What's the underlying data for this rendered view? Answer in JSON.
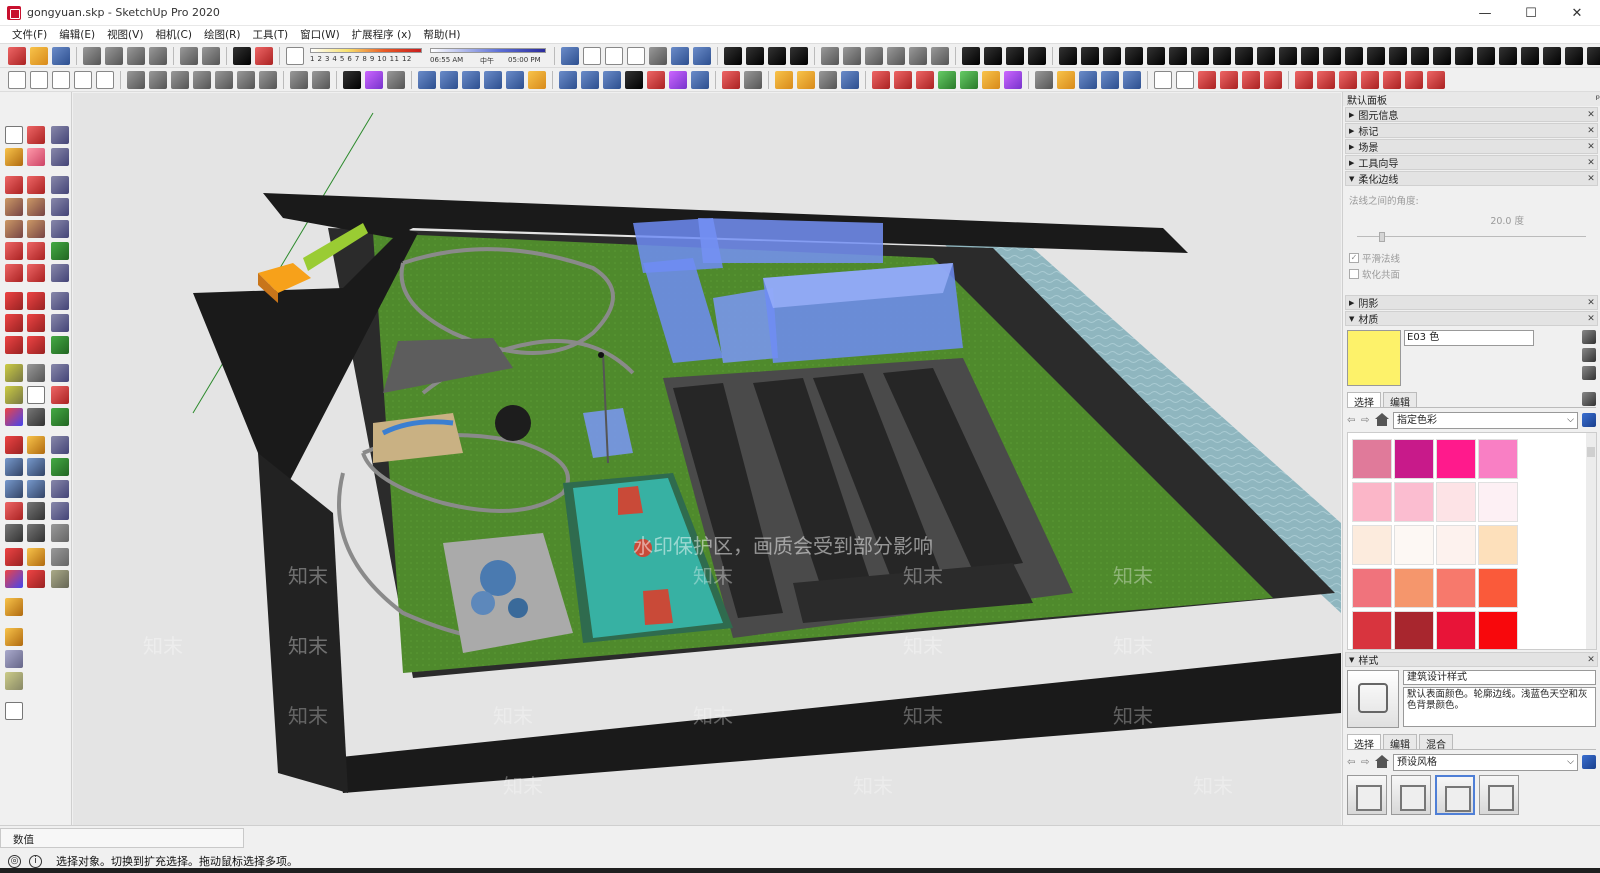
{
  "window": {
    "title": "gongyuan.skp - SketchUp Pro 2020",
    "controls": {
      "minimize": "—",
      "maximize": "☐",
      "close": "✕"
    }
  },
  "menubar": [
    "文件(F)",
    "编辑(E)",
    "视图(V)",
    "相机(C)",
    "绘图(R)",
    "工具(T)",
    "窗口(W)",
    "扩展程序 (x)",
    "帮助(H)"
  ],
  "toolbar": {
    "shadow_ticks": "1 2 3 4 5 6 7 8 9 10 11 12",
    "time_start": "06:55 AM",
    "time_mid": "中午",
    "time_end": "05:00 PM"
  },
  "right_panel": {
    "title": "默认面板",
    "pin": "ᵖ",
    "sections": [
      {
        "label": "图元信息",
        "expanded": false
      },
      {
        "label": "标记",
        "expanded": false
      },
      {
        "label": "场景",
        "expanded": false
      },
      {
        "label": "工具向导",
        "expanded": false
      },
      {
        "label": "柔化边线",
        "expanded": true
      }
    ],
    "soften": {
      "angle_label": "法线之间的角度:",
      "angle_value": "20.0 度",
      "smooth_normals": "平滑法线",
      "soften_coplanar": "软化共面",
      "smooth_checked": true,
      "coplanar_checked": false
    },
    "shadow_section": "阴影",
    "materials_section": "材质",
    "materials": {
      "current_name": "E03 色",
      "current_color": "#fdf26a",
      "tab_select": "选择",
      "tab_edit": "编辑",
      "library": "指定色彩",
      "colors": [
        "#e07a9a",
        "#c81a8a",
        "#ff1a8c",
        "#f97fc4",
        "#fbb6c8",
        "#fbbdd0",
        "#fde3e6",
        "#fdf0f4",
        "#fcebdd",
        "#fdf8f4",
        "#fdf2ee",
        "#fde0bb",
        "#f0737c",
        "#f5966c",
        "#f7796c",
        "#fa5a3a",
        "#d8343e",
        "#a8262e",
        "#e81438",
        "#f8080c"
      ]
    },
    "styles_section": "样式",
    "styles": {
      "name": "建筑设计样式",
      "description": "默认表面颜色。轮廓边线。浅蓝色天空和灰色背景颜色。",
      "tab_select": "选择",
      "tab_edit": "编辑",
      "tab_mix": "混合",
      "library": "预设风格"
    }
  },
  "watermark": "水印保护区，画质会受到部分影响",
  "watermark_brand": "知末",
  "measurements_label": "数值",
  "status_text": "选择对象。切换到扩充选择。拖动鼠标选择多项。"
}
